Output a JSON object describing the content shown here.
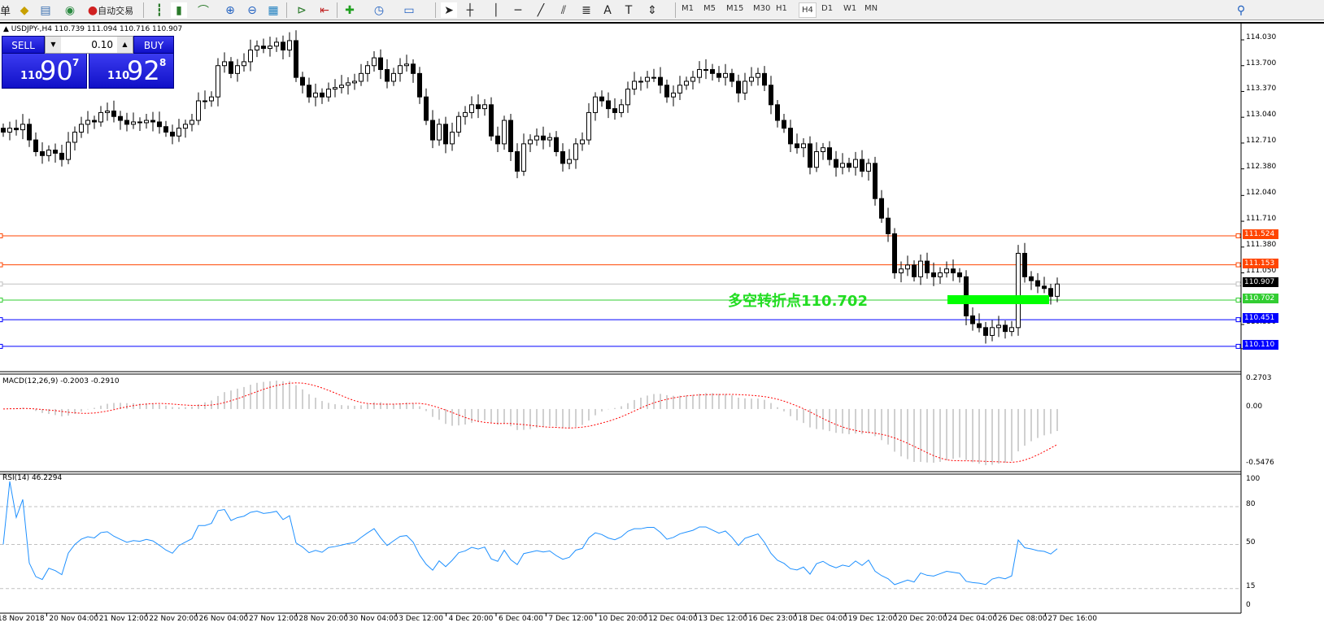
{
  "toolbar": {
    "menu_fragment": "单",
    "autotrade_label": "自动交易",
    "icons": [
      "orders-icon",
      "market-watch-icon",
      "signals-icon",
      "autotrade-icon",
      "bar-chart-icon",
      "candlestick-icon",
      "line-chart-icon",
      "zoom-in-icon",
      "zoom-out-icon",
      "tile-windows-icon",
      "autoscroll-icon",
      "chart-shift-icon",
      "indicators-icon",
      "periods-clock-icon",
      "templates-icon",
      "cursor-icon",
      "crosshair-icon",
      "vertical-line-icon",
      "horizontal-line-icon",
      "trendline-icon",
      "equidistant-channel-icon",
      "fibonacci-icon",
      "text-icon",
      "text-label-icon",
      "arrows-icon",
      "search-icon"
    ],
    "timeframes": [
      "M1",
      "M5",
      "M15",
      "M30",
      "H1",
      "H4",
      "D1",
      "W1",
      "MN"
    ],
    "active_timeframe": "H4",
    "text_tool": "A"
  },
  "chart": {
    "title": "USDJPY-,H4  110.739 111.094 110.716 110.907",
    "one_click": {
      "sell": "SELL",
      "buy": "BUY",
      "lot": "0.10",
      "sell_big": "110",
      "sell_pips": "90",
      "sell_frac": "7",
      "buy_big": "110",
      "buy_pips": "92",
      "buy_frac": "8"
    },
    "annotation": "多空转折点110.702",
    "price_ticks": [
      "114.030",
      "113.700",
      "113.370",
      "113.040",
      "112.710",
      "112.380",
      "112.040",
      "111.710",
      "111.380",
      "111.050",
      "110.390",
      "110.080"
    ],
    "hlines": [
      {
        "price": "111.524",
        "color": "#ff4500"
      },
      {
        "price": "111.153",
        "color": "#ff4500"
      },
      {
        "price": "110.907",
        "color": "#000000",
        "line": "#c0c0c0"
      },
      {
        "price": "110.702",
        "color": "#32cd32"
      },
      {
        "price": "110.451",
        "color": "#0000ff"
      },
      {
        "price": "110.110",
        "color": "#0000ff"
      }
    ],
    "closes": [
      112.85,
      112.9,
      112.88,
      112.95,
      112.75,
      112.6,
      112.55,
      112.62,
      112.58,
      112.5,
      112.72,
      112.85,
      112.95,
      113.0,
      112.98,
      113.1,
      113.12,
      113.05,
      113.0,
      112.95,
      112.98,
      112.97,
      113.0,
      112.98,
      112.92,
      112.85,
      112.8,
      112.9,
      112.95,
      113.0,
      113.25,
      113.25,
      113.3,
      113.7,
      113.75,
      113.6,
      113.7,
      113.75,
      113.9,
      113.95,
      113.92,
      113.95,
      114.0,
      113.9,
      114.02,
      113.55,
      113.45,
      113.3,
      113.35,
      113.3,
      113.4,
      113.42,
      113.45,
      113.48,
      113.5,
      113.6,
      113.7,
      113.8,
      113.65,
      113.5,
      113.6,
      113.7,
      113.72,
      113.6,
      113.3,
      113.0,
      112.75,
      112.95,
      112.7,
      112.85,
      113.05,
      113.1,
      113.2,
      113.15,
      113.2,
      112.8,
      112.7,
      113.0,
      112.6,
      112.35,
      112.7,
      112.75,
      112.8,
      112.75,
      112.78,
      112.6,
      112.45,
      112.5,
      112.7,
      112.75,
      113.1,
      113.3,
      113.25,
      113.15,
      113.1,
      113.2,
      113.4,
      113.5,
      113.5,
      113.55,
      113.55,
      113.45,
      113.3,
      113.35,
      113.45,
      113.5,
      113.55,
      113.65,
      113.65,
      113.6,
      113.55,
      113.6,
      113.5,
      113.35,
      113.5,
      113.55,
      113.6,
      113.45,
      113.2,
      113.0,
      112.9,
      112.7,
      112.65,
      112.7,
      112.4,
      112.6,
      112.65,
      112.5,
      112.4,
      112.45,
      112.4,
      112.5,
      112.35,
      112.45,
      112.0,
      111.75,
      111.55,
      111.05,
      111.1,
      111.15,
      111.0,
      111.2,
      111.05,
      111.0,
      111.05,
      111.1,
      111.05,
      111.0,
      110.5,
      110.4,
      110.35,
      110.25,
      110.35,
      110.38,
      110.3,
      110.35,
      111.3,
      111.0,
      110.95,
      110.88,
      110.85,
      110.75,
      110.907
    ]
  },
  "macd": {
    "label": "MACD(12,26,9) -0.2003 -0.2910",
    "ticks": [
      "0.2703",
      "0.00",
      "-0.5476"
    ]
  },
  "rsi": {
    "label": "RSI(14) 46.2294",
    "ticks": [
      "100",
      "80",
      "50",
      "15",
      "0"
    ],
    "color": "#1e90ff"
  },
  "time_axis": [
    "18 Nov 2018",
    "20 Nov 04:00",
    "21 Nov 12:00",
    "22 Nov 20:00",
    "26 Nov 04:00",
    "27 Nov 12:00",
    "28 Nov 20:00",
    "30 Nov 04:00",
    "3 Dec 12:00",
    "4 Dec 20:00",
    "6 Dec 04:00",
    "7 Dec 12:00",
    "10 Dec 20:00",
    "12 Dec 04:00",
    "13 Dec 12:00",
    "16 Dec 23:00",
    "18 Dec 04:00",
    "19 Dec 12:00",
    "20 Dec 20:00",
    "24 Dec 04:00",
    "26 Dec 08:00",
    "27 Dec 16:00"
  ]
}
